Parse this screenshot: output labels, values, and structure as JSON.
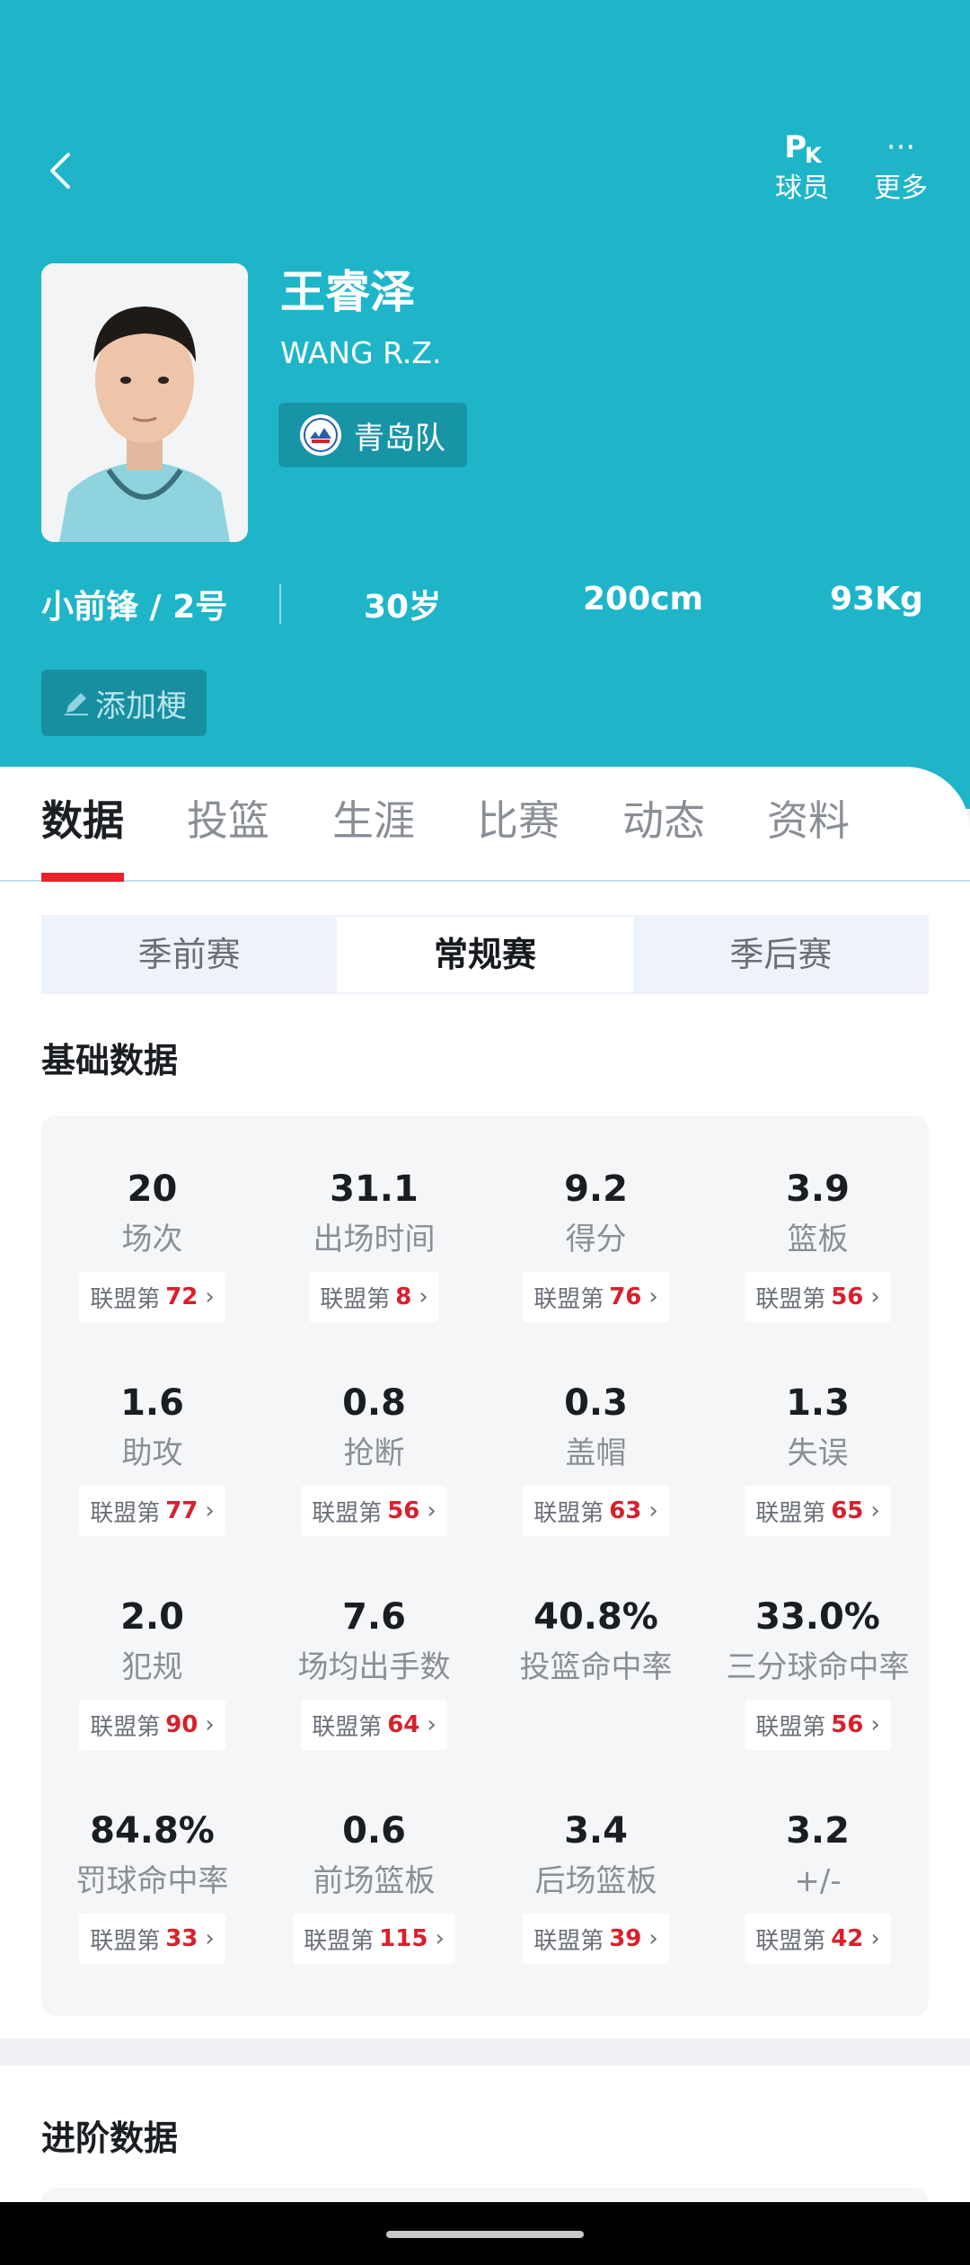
{
  "colors": {
    "header_bg": "#1eb5c9",
    "accent_red": "#e8242a",
    "rank_red": "#d8202c"
  },
  "header": {
    "back_icon": "chevron-left-icon",
    "actions": [
      {
        "icon": "pk-icon",
        "label": "球员"
      },
      {
        "icon": "more-dots-icon",
        "label": "更多"
      }
    ]
  },
  "player": {
    "name_cn": "王睿泽",
    "name_en": "WANG R.Z.",
    "team": "青岛队",
    "position_number": "小前锋 / 2号",
    "age": "30岁",
    "height": "200cm",
    "weight": "93Kg",
    "meme_button": "添加梗"
  },
  "tabs": [
    "数据",
    "投篮",
    "生涯",
    "比赛",
    "动态",
    "资料"
  ],
  "active_tab": "数据",
  "season_types": [
    "季前赛",
    "常规赛",
    "季后赛"
  ],
  "active_season_type": "常规赛",
  "basic_section": {
    "title": "基础数据",
    "rank_prefix": "联盟第"
  },
  "stats": [
    {
      "value": "20",
      "label": "场次",
      "rank": "72"
    },
    {
      "value": "31.1",
      "label": "出场时间",
      "rank": "8"
    },
    {
      "value": "9.2",
      "label": "得分",
      "rank": "76"
    },
    {
      "value": "3.9",
      "label": "篮板",
      "rank": "56"
    },
    {
      "value": "1.6",
      "label": "助攻",
      "rank": "77"
    },
    {
      "value": "0.8",
      "label": "抢断",
      "rank": "56"
    },
    {
      "value": "0.3",
      "label": "盖帽",
      "rank": "63"
    },
    {
      "value": "1.3",
      "label": "失误",
      "rank": "65"
    },
    {
      "value": "2.0",
      "label": "犯规",
      "rank": "90"
    },
    {
      "value": "7.6",
      "label": "场均出手数",
      "rank": "64"
    },
    {
      "value": "40.8%",
      "label": "投篮命中率",
      "rank": null
    },
    {
      "value": "33.0%",
      "label": "三分球命中率",
      "rank": "56"
    },
    {
      "value": "84.8%",
      "label": "罚球命中率",
      "rank": "33"
    },
    {
      "value": "0.6",
      "label": "前场篮板",
      "rank": "115"
    },
    {
      "value": "3.4",
      "label": "后场篮板",
      "rank": "39"
    },
    {
      "value": "3.2",
      "label": "+/-",
      "rank": "42"
    }
  ],
  "advanced_section": {
    "title": "进阶数据"
  }
}
